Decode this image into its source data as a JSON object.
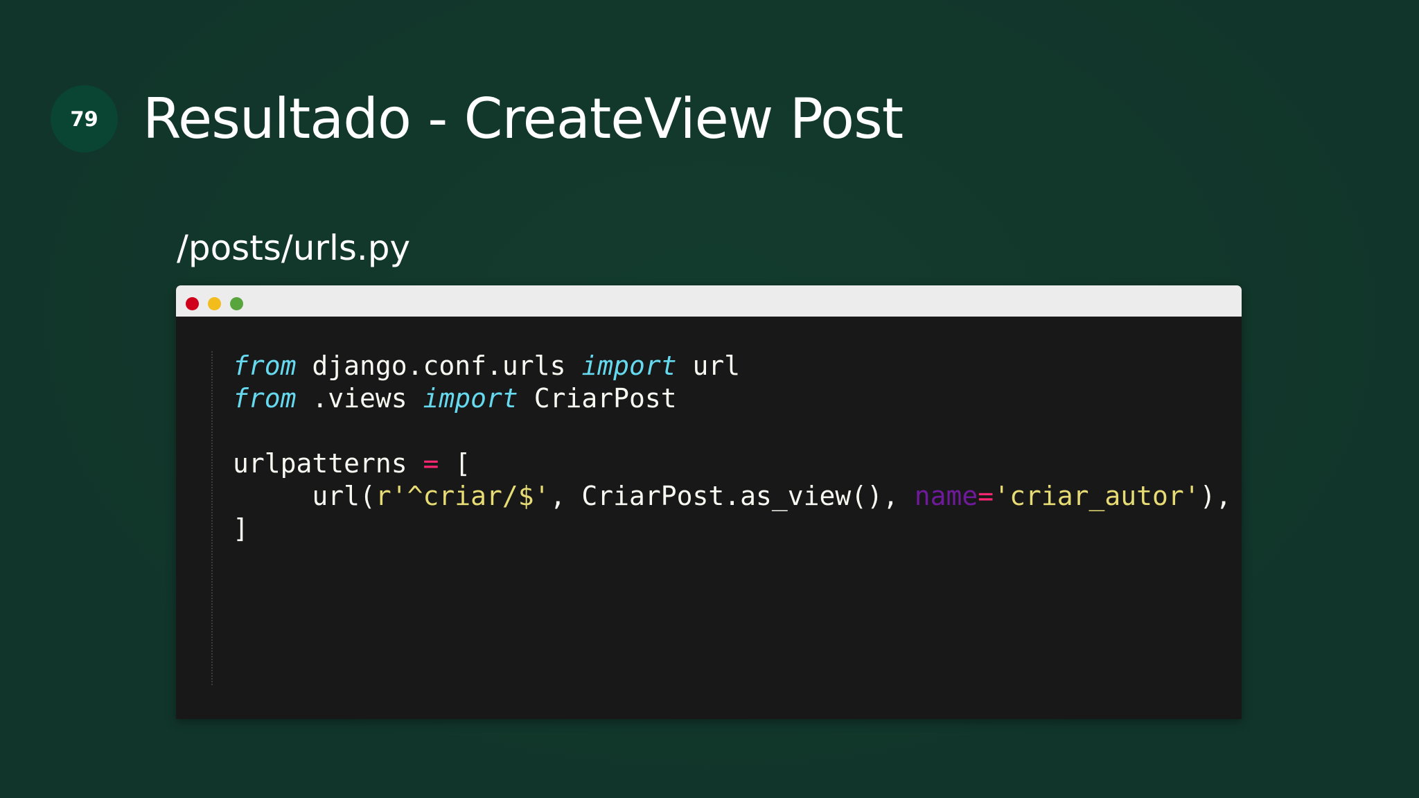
{
  "slide": {
    "number": "79",
    "title": "Resultado - CreateView Post",
    "file_path": "/posts/urls.py"
  },
  "window": {
    "buttons": [
      "close",
      "minimize",
      "maximize"
    ],
    "button_colors": [
      "#d0021b",
      "#f2bc1d",
      "#58a53d"
    ]
  },
  "code": {
    "line1": {
      "kw1": "from",
      "module": " django.conf.urls ",
      "kw2": "import",
      "name": " url"
    },
    "line2": {
      "kw1": "from",
      "module": " .views ",
      "kw2": "import",
      "name": " CriarPost"
    },
    "line4": {
      "var": "urlpatterns ",
      "op": "=",
      "bracket": " ["
    },
    "line5": {
      "indent": "     ",
      "call": "url(",
      "pattern": "r'^criar/$'",
      "args": ", CriarPost.as_view(), ",
      "kwarg": "name",
      "eq": "=",
      "name_value": "'criar_autor'",
      "close": "),"
    },
    "line6": {
      "bracket": "]"
    }
  },
  "colors": {
    "background": "#11352a",
    "badge": "#0a4432",
    "editor": "#181818",
    "keyword": "#66d9ef",
    "operator": "#f92672",
    "string": "#e6db74",
    "kwarg": "#6f1a9a"
  }
}
